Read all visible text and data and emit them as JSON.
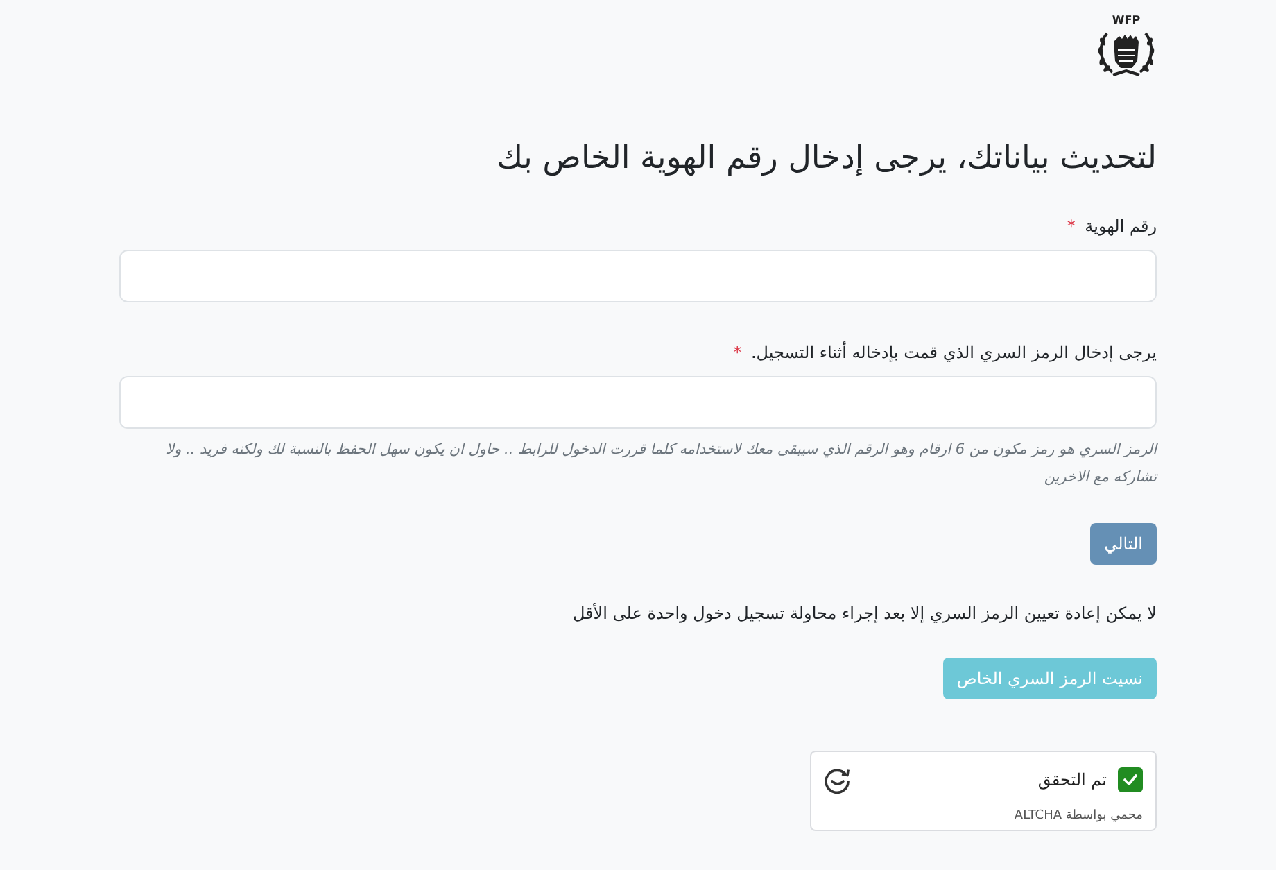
{
  "logo": {
    "text": "WFP"
  },
  "heading": "لتحديث بياناتك، يرجى إدخال رقم الهوية الخاص بك",
  "fields": [
    {
      "label": "رقم الهوية",
      "required_mark": "*"
    },
    {
      "label": "يرجى إدخال الرمز السري الذي قمت بإدخاله أثناء التسجيل.",
      "required_mark": "*",
      "help": "الرمز السري هو رمز مكون من 6 ارقام وهو الرقم الذي سيبقى معك لاستخدامه كلما قررت الدخول للرابط .. حاول ان يكون سهل الحفظ بالنسبة لك ولكنه فريد .. ولا تشاركه مع الاخرين"
    }
  ],
  "next_button": {
    "label": "التالي",
    "disabled": true
  },
  "note": "لا يمكن إعادة تعيين الرمز السري إلا بعد إجراء محاولة تسجيل دخول واحدة على الأقل",
  "forgot_button": {
    "label": "نسيت الرمز السري الخاص",
    "disabled": true
  },
  "captcha": {
    "label": "تم التحقق",
    "checked": true,
    "footer": "محمي بواسطة ALTCHA"
  }
}
